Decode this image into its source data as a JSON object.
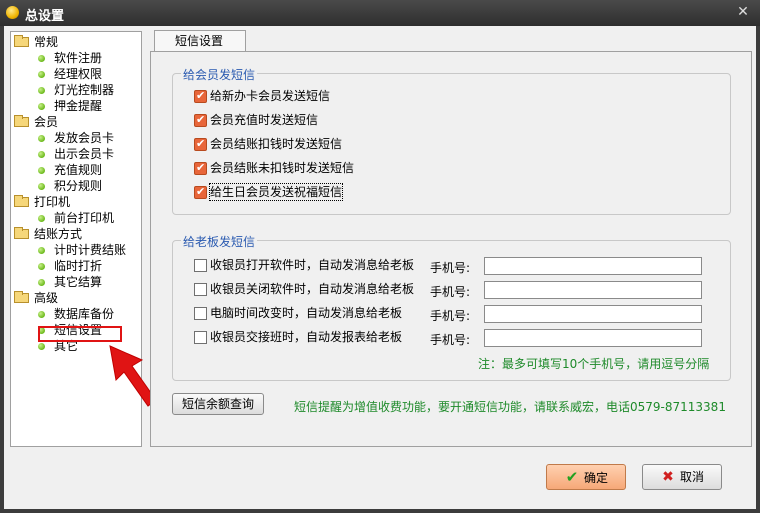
{
  "window": {
    "title": "总设置"
  },
  "tree": {
    "groups": [
      {
        "label": "常规",
        "items": [
          "软件注册",
          "经理权限",
          "灯光控制器",
          "押金提醒"
        ]
      },
      {
        "label": "会员",
        "items": [
          "发放会员卡",
          "出示会员卡",
          "充值规则",
          "积分规则"
        ]
      },
      {
        "label": "打印机",
        "items": [
          "前台打印机"
        ]
      },
      {
        "label": "结账方式",
        "items": [
          "计时计费结账",
          "临时打折",
          "其它结算"
        ]
      },
      {
        "label": "高级",
        "items": [
          "数据库备份",
          "短信设置",
          "其它"
        ]
      }
    ],
    "selected": "短信设置"
  },
  "tab": {
    "label": "短信设置"
  },
  "member_group": {
    "legend": "给会员发短信",
    "options": [
      {
        "label": "给新办卡会员发送短信",
        "checked": true
      },
      {
        "label": "会员充值时发送短信",
        "checked": true
      },
      {
        "label": "会员结账扣钱时发送短信",
        "checked": true
      },
      {
        "label": "会员结账未扣钱时发送短信",
        "checked": true
      },
      {
        "label": "给生日会员发送祝福短信",
        "checked": true
      }
    ]
  },
  "boss_group": {
    "legend": "给老板发短信",
    "options": [
      {
        "label": "收银员打开软件时，自动发消息给老板",
        "checked": false,
        "phone_label": "手机号:",
        "phone": ""
      },
      {
        "label": "收银员关闭软件时，自动发消息给老板",
        "checked": false,
        "phone_label": "手机号:",
        "phone": ""
      },
      {
        "label": "电脑时间改变时，自动发消息给老板",
        "checked": false,
        "phone_label": "手机号:",
        "phone": ""
      },
      {
        "label": "收银员交接班时，自动发报表给老板",
        "checked": false,
        "phone_label": "手机号:",
        "phone": ""
      }
    ],
    "note": "注：最多可填写10个手机号，请用逗号分隔"
  },
  "balance_button": "短信余额查询",
  "promo_text": "短信提醒为增值收费功能，要开通短信功能，请联系威宏，电话0579-87113381",
  "ok_button": "确定",
  "cancel_button": "取消",
  "colors": {
    "accent_green": "#1e8a2a",
    "legend_blue": "#2a5ab0",
    "highlight_red": "#e01414",
    "checkbox_orange": "#e8663a"
  }
}
